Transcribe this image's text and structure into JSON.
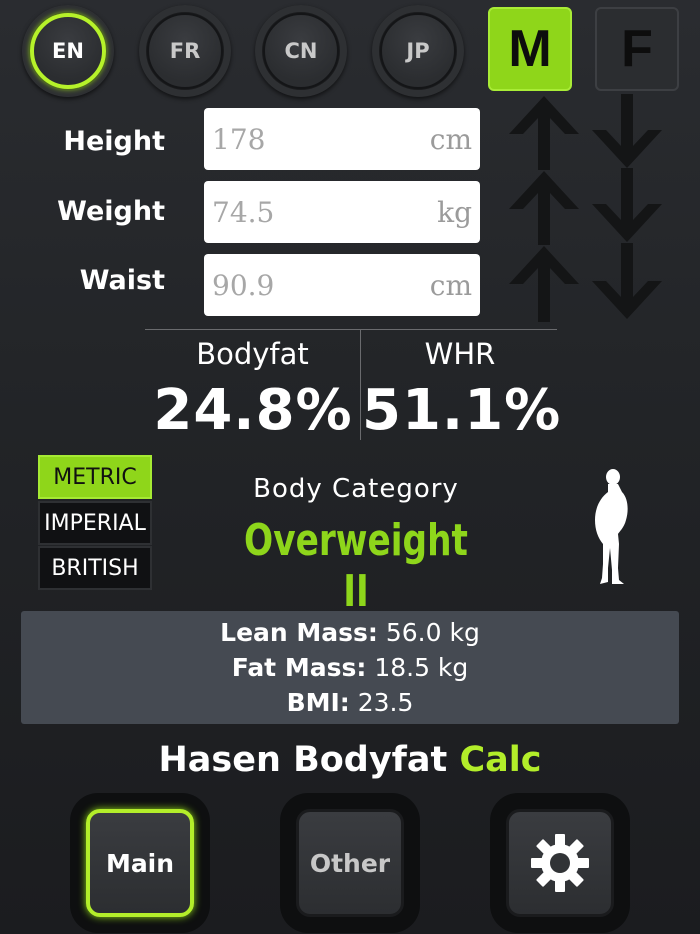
{
  "languages": [
    {
      "label": "EN",
      "active": true
    },
    {
      "label": "FR",
      "active": false
    },
    {
      "label": "CN",
      "active": false
    },
    {
      "label": "JP",
      "active": false
    }
  ],
  "gender": {
    "male_label": "M",
    "female_label": "F",
    "selected": "M"
  },
  "inputs": {
    "height": {
      "label": "Height",
      "value": "178",
      "unit": "cm"
    },
    "weight": {
      "label": "Weight",
      "value": "74.5",
      "unit": "kg"
    },
    "waist": {
      "label": "Waist",
      "value": "90.9",
      "unit": "cm"
    }
  },
  "results": {
    "bodyfat_label": "Bodyfat",
    "bodyfat_value": "24.8%",
    "whr_label": "WHR",
    "whr_value": "51.1%"
  },
  "units": [
    {
      "label": "METRIC",
      "active": true
    },
    {
      "label": "IMPERIAL",
      "active": false
    },
    {
      "label": "BRITISH",
      "active": false
    }
  ],
  "category": {
    "label": "Body Category",
    "value": "Overweight II"
  },
  "stats": {
    "lean_label": "Lean Mass:",
    "lean_value": "56.0 kg",
    "fat_label": "Fat Mass:",
    "fat_value": "18.5 kg",
    "bmi_label": "BMI:",
    "bmi_value": "23.5"
  },
  "app": {
    "name_part1": "Hasen Bodyfat",
    "name_part2": "Calc"
  },
  "nav": {
    "main_label": "Main",
    "other_label": "Other"
  },
  "colors": {
    "accent": "#8fd61a",
    "accent_bright": "#b3ee2a",
    "background": "#232528"
  }
}
